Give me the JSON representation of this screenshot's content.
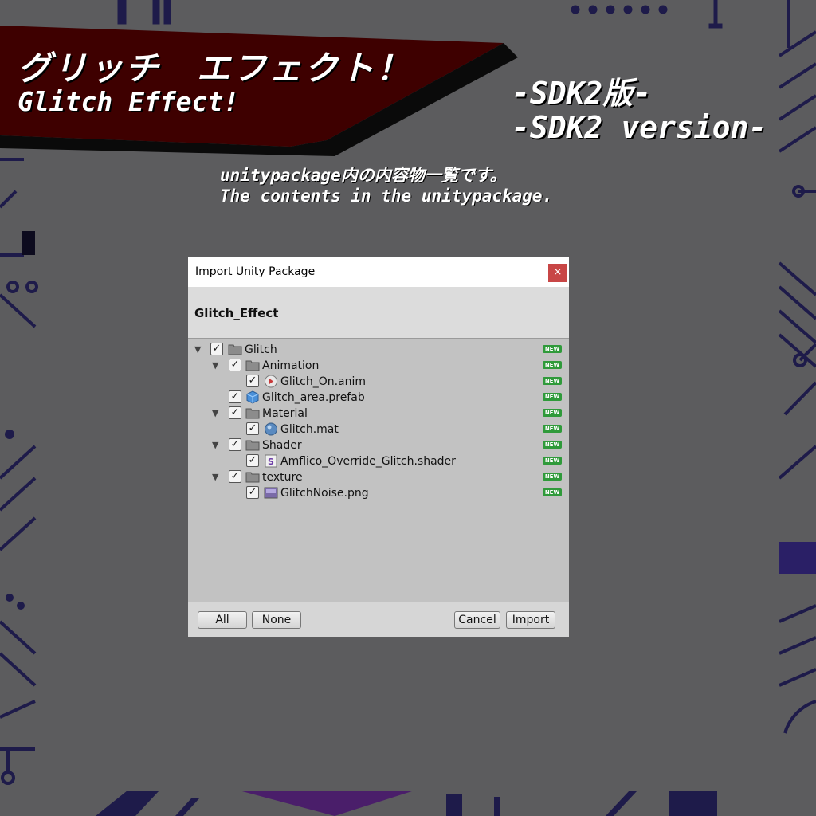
{
  "banner": {
    "title_jp": "グリッチ　エフェクト！",
    "title_en": "Glitch Effect!",
    "version_jp": "-SDK2版-",
    "version_en": "-SDK2 version-",
    "desc_jp": "unitypackage内の内容物一覧です。",
    "desc_en": "The contents in the unitypackage."
  },
  "dialog": {
    "window_title": "Import Unity Package",
    "close_label": "×",
    "package_name": "Glitch_Effect",
    "new_badge": "NEW",
    "items": [
      {
        "label": "Glitch",
        "icon": "folder-icon",
        "checked": true,
        "expanded": true
      },
      {
        "label": "Animation",
        "icon": "folder-icon",
        "checked": true,
        "expanded": true
      },
      {
        "label": "Glitch_On.anim",
        "icon": "animation-clip-icon",
        "checked": true
      },
      {
        "label": "Glitch_area.prefab",
        "icon": "prefab-icon",
        "checked": true
      },
      {
        "label": "Material",
        "icon": "folder-icon",
        "checked": true,
        "expanded": true
      },
      {
        "label": "Glitch.mat",
        "icon": "material-icon",
        "checked": true
      },
      {
        "label": "Shader",
        "icon": "folder-icon",
        "checked": true,
        "expanded": true
      },
      {
        "label": "Amflico_Override_Glitch.shader",
        "icon": "shader-icon",
        "checked": true
      },
      {
        "label": "texture",
        "icon": "folder-icon",
        "checked": true,
        "expanded": true
      },
      {
        "label": "GlitchNoise.png",
        "icon": "texture-icon",
        "checked": true
      }
    ],
    "buttons": {
      "all": "All",
      "none": "None",
      "cancel": "Cancel",
      "import": "Import"
    }
  },
  "colors": {
    "background": "#5c5c5e",
    "banner": "#3e0000",
    "new_badge": "#2f9a3a",
    "close_button": "#c84646"
  }
}
